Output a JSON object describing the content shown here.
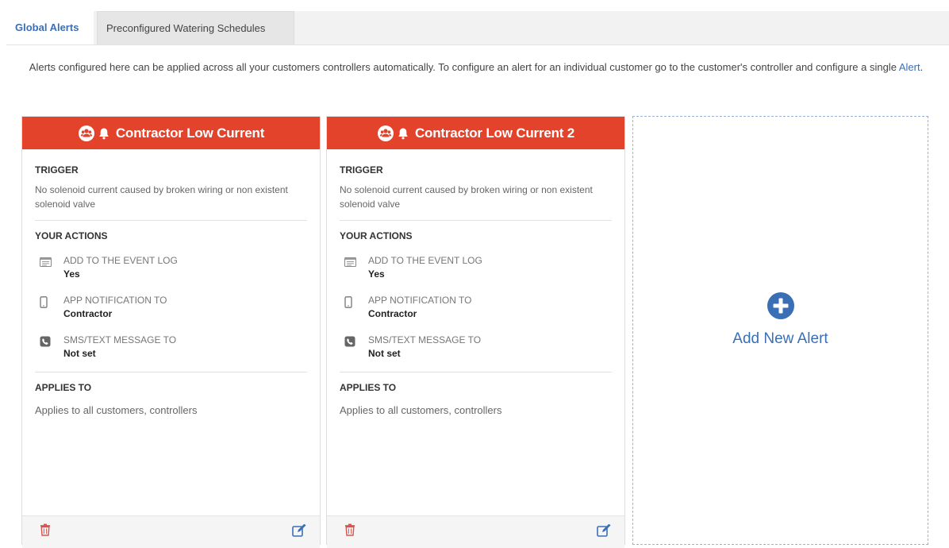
{
  "tabs": [
    {
      "label": "Global Alerts",
      "active": true
    },
    {
      "label": "Preconfigured Watering Schedules",
      "active": false
    }
  ],
  "intro": {
    "text": "Alerts configured here can be applied across all your customers controllers automatically. To configure an alert for an individual customer go to the customer's controller and configure a single ",
    "link": "Alert",
    "suffix": "."
  },
  "cards": [
    {
      "title": "Contractor Low Current",
      "trigger_heading": "TRIGGER",
      "trigger_text": "No solenoid current caused by broken wiring or non existent solenoid valve",
      "actions_heading": "YOUR ACTIONS",
      "actions": [
        {
          "icon": "event-log-icon",
          "label": "ADD TO THE EVENT LOG",
          "value": "Yes"
        },
        {
          "icon": "mobile-phone-icon",
          "label": "APP NOTIFICATION TO",
          "value": "Contractor"
        },
        {
          "icon": "phone-square-icon",
          "label": "SMS/TEXT MESSAGE TO",
          "value": "Not set"
        }
      ],
      "applies_heading": "APPLIES TO",
      "applies_text": "Applies to all customers, controllers"
    },
    {
      "title": "Contractor Low Current 2",
      "trigger_heading": "TRIGGER",
      "trigger_text": "No solenoid current caused by broken wiring or non existent solenoid valve",
      "actions_heading": "YOUR ACTIONS",
      "actions": [
        {
          "icon": "event-log-icon",
          "label": "ADD TO THE EVENT LOG",
          "value": "Yes"
        },
        {
          "icon": "mobile-phone-icon",
          "label": "APP NOTIFICATION TO",
          "value": "Contractor"
        },
        {
          "icon": "phone-square-icon",
          "label": "SMS/TEXT MESSAGE TO",
          "value": "Not set"
        }
      ],
      "applies_heading": "APPLIES TO",
      "applies_text": "Applies to all customers, controllers"
    }
  ],
  "add_alert": {
    "label": "Add New Alert",
    "icon": "plus-circle-icon"
  },
  "colors": {
    "header_red": "#e3432b",
    "link_blue": "#3a6fb6",
    "dashed_border": "#9ab3d6"
  }
}
